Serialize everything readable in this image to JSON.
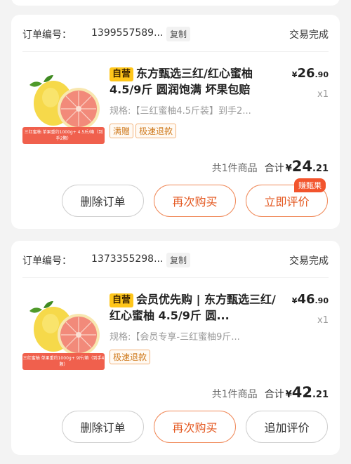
{
  "orders": [
    {
      "order_label": "订单编号：",
      "order_no": "1399557589...",
      "copy_label": "复制",
      "status": "交易完成",
      "self_tag": "自营",
      "title": "东方甄选三红/红心蜜柚4.5/9斤 圆润饱满 坏果包赔",
      "price_symbol": "¥",
      "price_int": "26",
      "price_dec": ".90",
      "qty": "x1",
      "spec": "规格:【三红蜜柚4.5斤装】到手2...",
      "img_banner": "三红蜜柚 单果重约1000g+ 4.5斤/箱（到手2颗）",
      "tags": [
        "满赠",
        "极速退款"
      ],
      "item_count": "共1件商品",
      "total_label": "合计",
      "total_symbol": "¥",
      "total_int": "24",
      "total_dec": ".21",
      "buttons": [
        "删除订单",
        "再次购买",
        "立即评价"
      ],
      "badge": "赚甄果"
    },
    {
      "order_label": "订单编号：",
      "order_no": "1373355298...",
      "copy_label": "复制",
      "status": "交易完成",
      "self_tag": "自营",
      "title": "会员优先购 | 东方甄选三红/红心蜜柚 4.5/9斤 圆...",
      "price_symbol": "¥",
      "price_int": "46",
      "price_dec": ".90",
      "qty": "x1",
      "spec": "规格:【会员专享-三红蜜柚9斤...",
      "img_banner": "三红蜜柚 单果重约1000g+ 9斤/箱（到手4颗）",
      "tags": [
        "极速退款"
      ],
      "item_count": "共1件商品",
      "total_label": "合计",
      "total_symbol": "¥",
      "total_int": "42",
      "total_dec": ".21",
      "buttons": [
        "删除订单",
        "再次购买",
        "追加评价"
      ]
    }
  ]
}
